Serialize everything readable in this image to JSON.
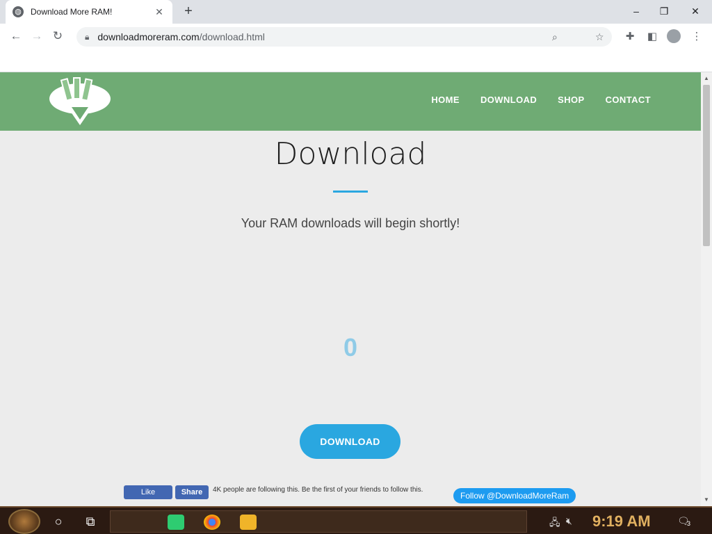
{
  "browser": {
    "tab_title": "Download More RAM!",
    "tab_close": "✕",
    "new_tab": "+",
    "url_host": "downloadmoreram.com",
    "url_path": "/download.html",
    "window_controls": {
      "minimize": "–",
      "maximize": "❐",
      "close": "✕"
    }
  },
  "site": {
    "nav": [
      "HOME",
      "DOWNLOAD",
      "SHOP",
      "CONTACT"
    ],
    "title": "Download",
    "subtitle": "Your RAM downloads will begin shortly!",
    "counter": "0",
    "download_button": "DOWNLOAD",
    "facebook": {
      "like": "Like",
      "share": "Share",
      "text": "4K people are following this. Be the first of your friends to follow this."
    },
    "twitter_follow": "Follow @DownloadMoreRam",
    "colors": {
      "header": "#6fab74",
      "accent": "#2aa7e0",
      "counter": "#8fcbe7"
    }
  },
  "taskbar": {
    "clock": "9:19 AM",
    "notification_count": "3"
  },
  "icons": [
    "search-icon",
    "star-icon",
    "extensions-icon",
    "sidebar-icon",
    "profile-icon",
    "menu-icon",
    "lock-icon"
  ]
}
